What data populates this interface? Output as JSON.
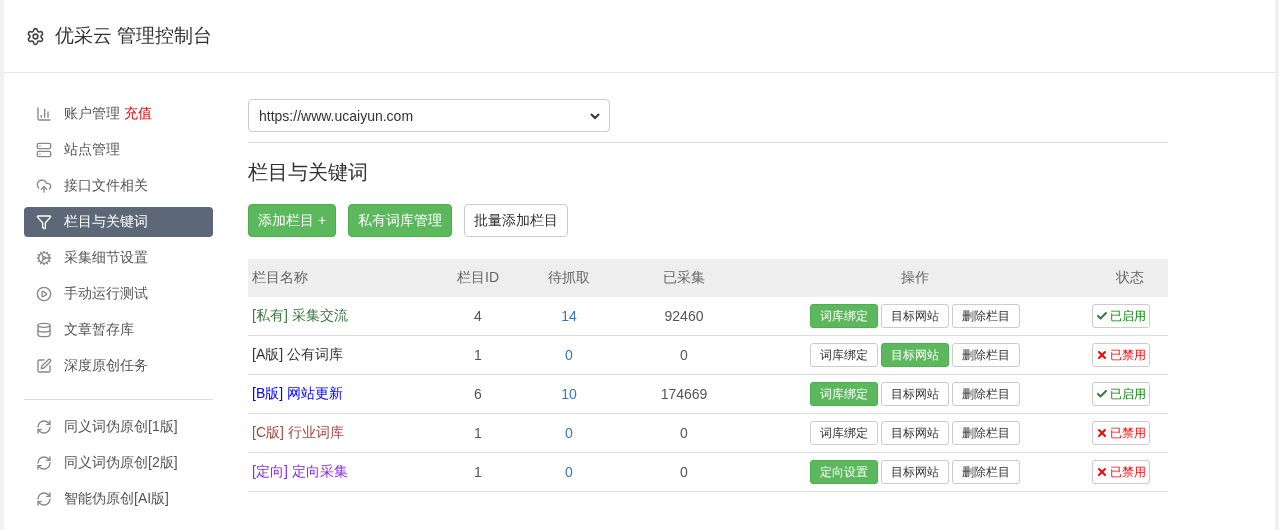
{
  "header": {
    "title": "优采云 管理控制台"
  },
  "sidebar": {
    "groups": [
      {
        "items": [
          {
            "label": "账户管理",
            "badge": "充值",
            "selected": false
          },
          {
            "label": "站点管理",
            "selected": false
          },
          {
            "label": "接口文件相关",
            "selected": false
          },
          {
            "label": "栏目与关键词",
            "selected": true
          },
          {
            "label": "采集细节设置",
            "selected": false
          },
          {
            "label": "手动运行测试",
            "selected": false
          },
          {
            "label": "文章暂存库",
            "selected": false
          },
          {
            "label": "深度原创任务",
            "selected": false
          }
        ]
      },
      {
        "items": [
          {
            "label": "同义词伪原创[1版]",
            "selected": false
          },
          {
            "label": "同义词伪原创[2版]",
            "selected": false
          },
          {
            "label": "智能伪原创[AI版]",
            "selected": false
          }
        ]
      }
    ]
  },
  "site_select": {
    "value": "https://www.ucaiyun.com"
  },
  "section_title": "栏目与关键词",
  "toolbar": [
    {
      "label": "添加栏目 +",
      "kind": "primary"
    },
    {
      "label": "私有词库管理",
      "kind": "primary"
    },
    {
      "label": "批量添加栏目",
      "kind": "default"
    }
  ],
  "table": {
    "columns": [
      "栏目名称",
      "栏目ID",
      "待抓取",
      "已采集",
      "操作",
      "状态"
    ],
    "rows": [
      {
        "name": "[私有] 采集交流",
        "color": "#3c763d",
        "id": "4",
        "pending": "14",
        "collected": "92460",
        "actions": [
          {
            "label": "词库绑定",
            "highlighted": true
          },
          {
            "label": "目标网站",
            "highlighted": false
          },
          {
            "label": "删除栏目",
            "highlighted": false
          }
        ],
        "status": {
          "label": "已启用",
          "enabled": true
        }
      },
      {
        "name": "[A版] 公有词库",
        "color": "#333333",
        "id": "1",
        "pending": "0",
        "collected": "0",
        "actions": [
          {
            "label": "词库绑定",
            "highlighted": false
          },
          {
            "label": "目标网站",
            "highlighted": true
          },
          {
            "label": "删除栏目",
            "highlighted": false
          }
        ],
        "status": {
          "label": "已禁用",
          "enabled": false
        }
      },
      {
        "name": "[B版] 网站更新",
        "color": "#0000ff",
        "id": "6",
        "pending": "10",
        "collected": "174669",
        "actions": [
          {
            "label": "词库绑定",
            "highlighted": true
          },
          {
            "label": "目标网站",
            "highlighted": false
          },
          {
            "label": "删除栏目",
            "highlighted": false
          }
        ],
        "status": {
          "label": "已启用",
          "enabled": true
        }
      },
      {
        "name": "[C版] 行业词库",
        "color": "#a94442",
        "id": "1",
        "pending": "0",
        "collected": "0",
        "actions": [
          {
            "label": "词库绑定",
            "highlighted": false
          },
          {
            "label": "目标网站",
            "highlighted": false
          },
          {
            "label": "删除栏目",
            "highlighted": false
          }
        ],
        "status": {
          "label": "已禁用",
          "enabled": false
        }
      },
      {
        "name": "[定向] 定向采集",
        "color": "#8a2be2",
        "id": "1",
        "pending": "0",
        "collected": "0",
        "actions": [
          {
            "label": "定向设置",
            "highlighted": true
          },
          {
            "label": "目标网站",
            "highlighted": false
          },
          {
            "label": "删除栏目",
            "highlighted": false
          }
        ],
        "status": {
          "label": "已禁用",
          "enabled": false
        }
      }
    ]
  }
}
